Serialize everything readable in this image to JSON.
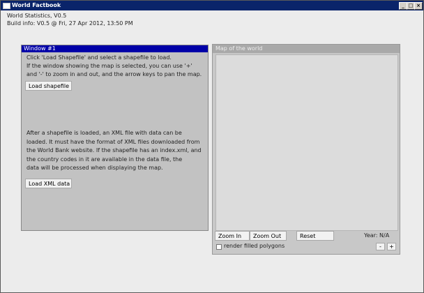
{
  "window": {
    "title": "World Factbook",
    "minimize_glyph": "_",
    "maximize_glyph": "□",
    "close_glyph": "×"
  },
  "header": {
    "app_name": "World Statistics, V0.5",
    "build_info": "Build info: V0.5 @ Fri, 27 Apr 2012, 13:50 PM"
  },
  "panel1": {
    "title": "Window #1",
    "instructions": [
      "Click 'Load Shapefile' and select a shapefile to load.",
      "If the window showing the map is selected, you can use '+'",
      "and '-' to zoom in and out, and the arrow keys to pan the map."
    ],
    "load_shapefile_label": "Load shapefile",
    "xml_instructions": [
      "After a shapefile is loaded, an XML file with data can be",
      "loaded. It must have the format of XML files downloaded from",
      "the World Bank website. If the shapefile has an index.xml, and",
      "the country codes in it are available in the data file, the",
      "data will be processed when displaying the map."
    ],
    "load_xml_label": "Load XML data"
  },
  "map_panel": {
    "title": "Map of the world",
    "zoom_in_label": "Zoom In",
    "zoom_out_label": "Zoom Out",
    "reset_label": "Reset",
    "year_text": "Year: N/A",
    "render_filled_label": "render filled polygons",
    "render_filled_checked": false,
    "minus_label": "-",
    "plus_label": "+"
  }
}
